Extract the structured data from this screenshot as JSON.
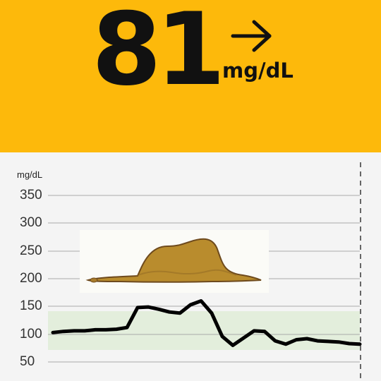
{
  "header": {
    "glucose_value": "81",
    "unit": "mg/dL",
    "trend": "right-arrow-icon",
    "color": "#FDB90B"
  },
  "chart": {
    "unit_label": "mg/dL",
    "y_ticks": [
      "350",
      "300",
      "250",
      "200",
      "150",
      "100",
      "50"
    ],
    "target_range_color": "#E3EEDC",
    "line_color": "#000000"
  },
  "chart_data": {
    "type": "line",
    "title": "",
    "xlabel": "",
    "ylabel": "mg/dL",
    "ylim": [
      40,
      365
    ],
    "target_range": [
      70,
      140
    ],
    "grid": true,
    "legend": "none",
    "series": [
      {
        "values": [
          103,
          105,
          106,
          106,
          108,
          108,
          109,
          112,
          148,
          149,
          145,
          140,
          138,
          153,
          160,
          138,
          96,
          80,
          93,
          106,
          105,
          88,
          82,
          90,
          92,
          88,
          87,
          86,
          83,
          82
        ]
      }
    ]
  },
  "image": {
    "icon": "hat-or-elephant-drawing-icon"
  }
}
